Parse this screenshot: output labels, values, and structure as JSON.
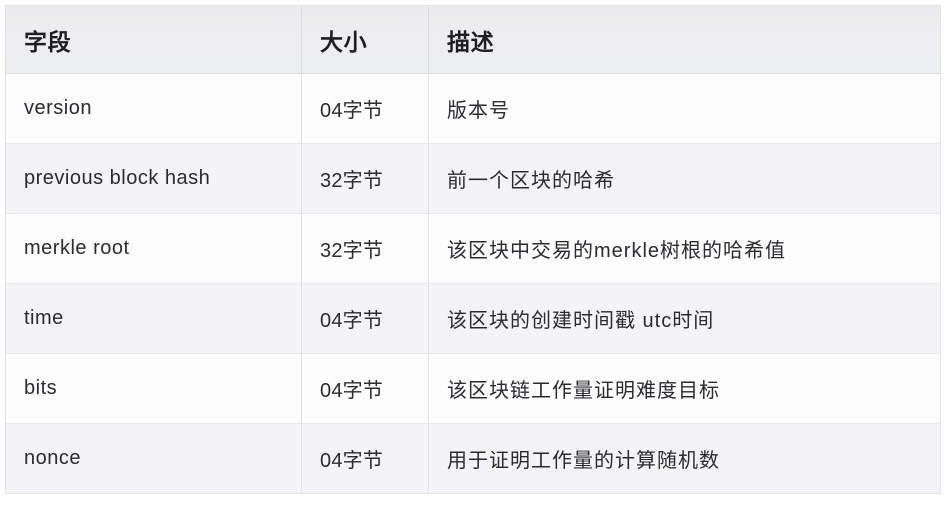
{
  "table": {
    "columns": [
      {
        "key": "field",
        "label": "字段"
      },
      {
        "key": "size",
        "label": "大小"
      },
      {
        "key": "desc",
        "label": "描述"
      }
    ],
    "rows": [
      {
        "field": "version",
        "size": "04字节",
        "desc": "版本号"
      },
      {
        "field": "previous block hash",
        "size": "32字节",
        "desc": "前一个区块的哈希"
      },
      {
        "field": "merkle root",
        "size": "32字节",
        "desc": "该区块中交易的merkle树根的哈希值"
      },
      {
        "field": "time",
        "size": "04字节",
        "desc": "该区块的创建时间戳 utc时间"
      },
      {
        "field": "bits",
        "size": "04字节",
        "desc": "该区块链工作量证明难度目标"
      },
      {
        "field": "nonce",
        "size": "04字节",
        "desc": "用于证明工作量的计算随机数"
      }
    ]
  },
  "colors": {
    "header_background": "#eeeef1",
    "row_stripe": "#f4f4f6",
    "row_plain": "#fdfdfe",
    "border": "#e0e0e6",
    "text": "#2b2b30",
    "header_text": "#1f1f22"
  }
}
